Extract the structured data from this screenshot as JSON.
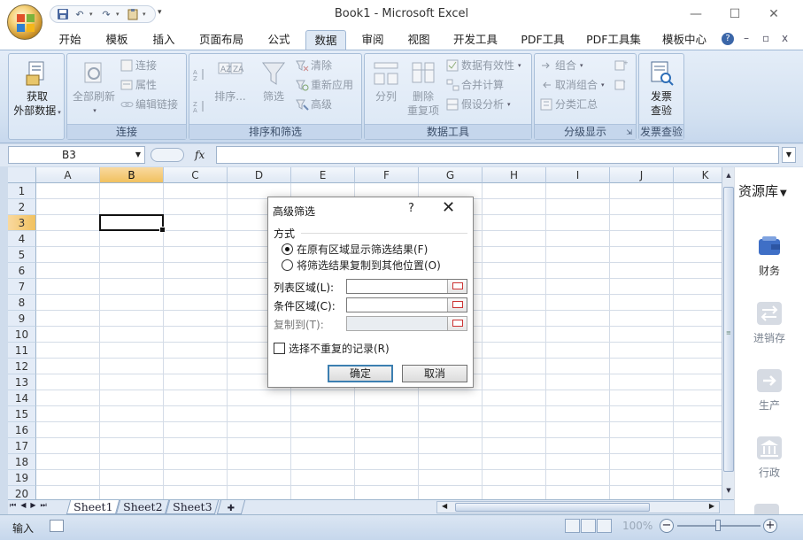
{
  "window": {
    "title": "Book1 - Microsoft Excel",
    "minimize": "—",
    "maximize": "☐",
    "close": "✕"
  },
  "tabs": [
    "开始",
    "模板",
    "插入",
    "页面布局",
    "公式",
    "数据",
    "审阅",
    "视图",
    "开发工具",
    "PDF工具",
    "PDF工具集",
    "模板中心"
  ],
  "active_tab": "数据",
  "tab_right": {
    "help": "?",
    "min": "–",
    "restore": "▫",
    "close": "x"
  },
  "ribbon": {
    "group_external": {
      "big_label_1": "获取",
      "big_label_2": "外部数据"
    },
    "group_connections": {
      "label": "连接",
      "refresh_1": "全部刷新",
      "connections": "连接",
      "properties": "属性",
      "edit_links": "编辑链接"
    },
    "group_sort": {
      "label": "排序和筛选",
      "sort": "排序...",
      "filter": "筛选",
      "clear": "清除",
      "reapply": "重新应用",
      "advanced": "高级",
      "az": "AZ",
      "za": "ZA"
    },
    "group_tools": {
      "label": "数据工具",
      "split": "分列",
      "remove_1": "删除",
      "remove_2": "重复项",
      "validation": "数据有效性",
      "consolidate": "合并计算",
      "whatif": "假设分析"
    },
    "group_outline": {
      "label": "分级显示",
      "group": "组合",
      "ungroup": "取消组合",
      "subtotal": "分类汇总"
    },
    "group_invoice": {
      "label": "发票查验",
      "big_1": "发票",
      "big_2": "查验"
    }
  },
  "formula_bar": {
    "name_box": "B3",
    "fx": "fx",
    "value": ""
  },
  "columns": [
    "A",
    "B",
    "C",
    "D",
    "E",
    "F",
    "G",
    "H",
    "I",
    "J",
    "K"
  ],
  "rows": [
    "1",
    "2",
    "3",
    "4",
    "5",
    "6",
    "7",
    "8",
    "9",
    "10",
    "11",
    "12",
    "13",
    "14",
    "15",
    "16",
    "17",
    "18",
    "19",
    "20"
  ],
  "selected_cell": "B3",
  "sheets": [
    "Sheet1",
    "Sheet2",
    "Sheet3"
  ],
  "active_sheet": "Sheet1",
  "status": {
    "mode": "输入",
    "zoom": "100%",
    "minus": "−",
    "plus": "+"
  },
  "side_panel": {
    "title": "资源库",
    "items": [
      "财务",
      "进销存",
      "生产",
      "行政"
    ]
  },
  "dialog": {
    "title": "高级筛选",
    "help": "?",
    "close": "✕",
    "group_label": "方式",
    "option_1": "在原有区域显示筛选结果(F)",
    "option_2": "将筛选结果复制到其他位置(O)",
    "list_range": "列表区域(L):",
    "criteria_range": "条件区域(C):",
    "copy_to": "复制到(T):",
    "list_value": "",
    "criteria_value": "",
    "copy_value": "",
    "unique_only": "选择不重复的记录(R)",
    "ok": "确定",
    "cancel": "取消"
  }
}
